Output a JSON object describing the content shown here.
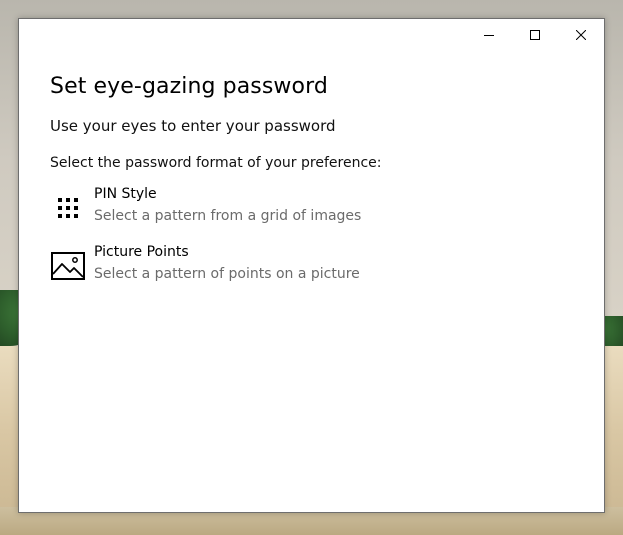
{
  "window": {
    "title": "Set eye-gazing password",
    "subtitle": "Use your eyes to enter your password",
    "prompt": "Select the password format of your preference:"
  },
  "caption_buttons": {
    "minimize": "minimize-icon",
    "maximize": "maximize-icon",
    "close": "close-icon"
  },
  "options": [
    {
      "title": "PIN Style",
      "description": "Select a pattern from a grid of images",
      "icon": "dot-grid-icon"
    },
    {
      "title": "Picture Points",
      "description": "Select a pattern of points on a picture",
      "icon": "picture-icon"
    }
  ],
  "colors": {
    "window_bg": "#ffffff",
    "secondary_text": "#6b6b6b"
  }
}
